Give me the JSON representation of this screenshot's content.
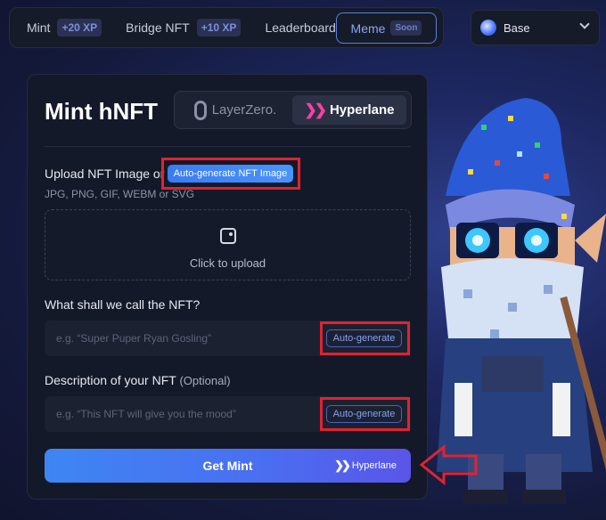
{
  "nav": {
    "mint_label": "Mint",
    "mint_xp": "+20 XP",
    "bridge_label": "Bridge NFT",
    "bridge_xp": "+10 XP",
    "leaderboard_label": "Leaderboard",
    "meme_label": "Meme",
    "meme_badge": "Soon"
  },
  "chain": {
    "selected": "Base"
  },
  "card": {
    "title": "Mint hNFT",
    "bridge_options": [
      {
        "label": "LayerZero.",
        "active": false
      },
      {
        "label": "Hyperlane",
        "active": true
      }
    ],
    "upload": {
      "label": "Upload NFT Image or",
      "autogen_label": "Auto-generate NFT Image",
      "formats": "JPG, PNG, GIF, WEBM or SVG",
      "dropzone_text": "Click to upload"
    },
    "name_field": {
      "label": "What shall we call the NFT?",
      "placeholder": "e.g. “Super Puper Ryan Gosling”",
      "autogen_label": "Auto-generate"
    },
    "description_field": {
      "label": "Description of your NFT",
      "optional": "(Optional)",
      "placeholder": "e.g. “This NFT will give you the mood”",
      "autogen_label": "Auto-generate"
    },
    "mint_button": {
      "label": "Get Mint",
      "via": "Hyperlane"
    }
  },
  "colors": {
    "accent": "#4a7cf3",
    "annotation_red": "#e0232e",
    "hyperlane_pink": "#ff3fa6"
  },
  "icons": [
    "layerzero-icon",
    "hyperlane-icon",
    "image-upload-icon",
    "chevron-down-icon",
    "chain-base-icon"
  ]
}
